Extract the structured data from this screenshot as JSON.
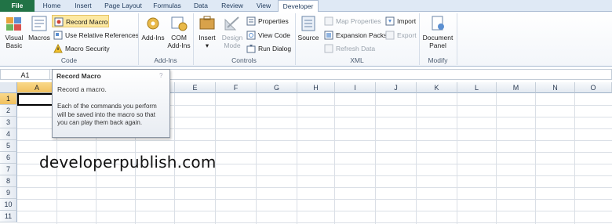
{
  "tabs": [
    "File",
    "Home",
    "Insert",
    "Page Layout",
    "Formulas",
    "Data",
    "Review",
    "View",
    "Developer"
  ],
  "active_tab": "Developer",
  "ribbon": {
    "code": {
      "label": "Code",
      "visual_basic": "Visual Basic",
      "macros": "Macros",
      "record_macro": "Record Macro",
      "use_relative": "Use Relative References",
      "macro_security": "Macro Security"
    },
    "addins": {
      "label": "Add-Ins",
      "addins": "Add-Ins",
      "com_addins": "COM Add-Ins"
    },
    "controls": {
      "label": "Controls",
      "insert": "Insert",
      "design_mode": "Design Mode",
      "properties": "Properties",
      "view_code": "View Code",
      "run_dialog": "Run Dialog"
    },
    "xml": {
      "label": "XML",
      "source": "Source",
      "map_properties": "Map Properties",
      "expansion_packs": "Expansion Packs",
      "refresh_data": "Refresh Data",
      "import": "Import",
      "export": "Export"
    },
    "modify": {
      "label": "Modify",
      "document_panel": "Document Panel"
    }
  },
  "name_box": "A1",
  "columns": [
    "A",
    "B",
    "C",
    "D",
    "E",
    "F",
    "G",
    "H",
    "I",
    "J",
    "K",
    "L",
    "M",
    "N",
    "O"
  ],
  "rows": [
    "1",
    "2",
    "3",
    "4",
    "5",
    "6",
    "7",
    "8",
    "9",
    "10",
    "11"
  ],
  "selected_cell": {
    "column": "A",
    "row": "1"
  },
  "tooltip": {
    "title": "Record Macro",
    "subtitle": "Record a macro.",
    "description": "Each of the commands you perform will be saved into the macro so that you can play them back again."
  },
  "watermark": "developerpublish.com",
  "colors": {
    "file_tab": "#217346",
    "selected_header": "#f1c15f",
    "highlight_button": "#fde9a2"
  }
}
